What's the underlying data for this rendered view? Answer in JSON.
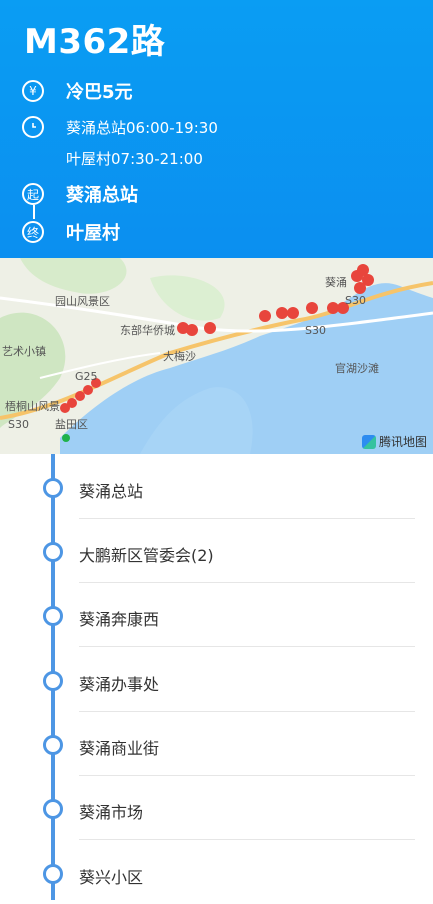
{
  "header": {
    "route_title": "M362路",
    "fare_icon": "yen-icon",
    "fare": "冷巴5元",
    "time_icon": "clock-icon",
    "schedule_line1": "葵涌总站06:00-19:30",
    "schedule_line2": "叶屋村07:30-21:00",
    "start_badge": "起",
    "start_station": "葵涌总站",
    "end_badge": "终",
    "end_station": "叶屋村",
    "background_color": "#0b93f1"
  },
  "map": {
    "labels": [
      "葵涌",
      "园山风景区",
      "东部华侨城",
      "大梅沙",
      "艺术小镇",
      "G25",
      "梧桐山风景",
      "盐田区",
      "S30",
      "S30",
      "S30",
      "官湖沙滩"
    ],
    "provider": "腾讯地图",
    "marker_color": "#e8453c"
  },
  "stops": [
    {
      "name": "葵涌总站"
    },
    {
      "name": "大鹏新区管委会(2)"
    },
    {
      "name": "葵涌奔康西"
    },
    {
      "name": "葵涌办事处"
    },
    {
      "name": "葵涌商业街"
    },
    {
      "name": "葵涌市场"
    },
    {
      "name": "葵兴小区"
    }
  ],
  "line_color": "#4d96e4"
}
